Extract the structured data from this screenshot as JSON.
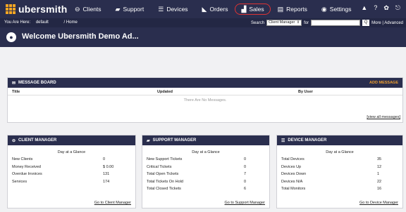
{
  "app": {
    "logo_text": "ubersmith"
  },
  "nav": [
    {
      "label": "Clients",
      "icon": "user-circle-icon",
      "glyph": "⊖"
    },
    {
      "label": "Support",
      "icon": "folder-icon",
      "glyph": "▰"
    },
    {
      "label": "Devices",
      "icon": "server-icon",
      "glyph": "☰"
    },
    {
      "label": "Orders",
      "icon": "tag-icon",
      "glyph": "◣"
    },
    {
      "label": "Sales",
      "icon": "bar-chart-icon",
      "glyph": "▟"
    },
    {
      "label": "Reports",
      "icon": "report-icon",
      "glyph": "▤"
    },
    {
      "label": "Settings",
      "icon": "settings-icon",
      "glyph": "◉"
    }
  ],
  "top_icons": {
    "bell": "▲",
    "help": "?",
    "gear": "✿",
    "logout": "⎋"
  },
  "subbar": {
    "you_are_here": "You Are Here:",
    "brand": "default",
    "breadcrumb_sep": "/",
    "breadcrumb_home": "Home",
    "search_label": "Search",
    "search_select": "Client Manager",
    "for_label": "for",
    "search_value": "",
    "search_button": "Q",
    "more_link": "More | Advanced"
  },
  "welcome": {
    "title": "Welcome Ubersmith Demo Ad..."
  },
  "message_board": {
    "title": "MESSAGE BOARD",
    "add_label": "ADD MESSAGE",
    "columns": [
      "Title",
      "Updated",
      "By User"
    ],
    "empty": "There Are No Messages.",
    "view_all": "[view all messages]"
  },
  "client_manager": {
    "title": "CLIENT MANAGER",
    "glance": "Day at a Glance",
    "rows": [
      {
        "label": "New Clients",
        "value": "0"
      },
      {
        "label": "Money Received",
        "value": "$ 0.00"
      },
      {
        "label": "Overdue Invoices",
        "value": "131"
      },
      {
        "label": "Services",
        "value": "174"
      }
    ],
    "link": "Go to Client Manager"
  },
  "support_manager": {
    "title": "SUPPORT MANAGER",
    "glance": "Day at a Glance",
    "rows": [
      {
        "label": "New Support Tickets",
        "value": "0"
      },
      {
        "label": "Critical Tickets",
        "value": "0"
      },
      {
        "label": "Total Open Tickets",
        "value": "7"
      },
      {
        "label": "Total Tickets On Hold",
        "value": "0"
      },
      {
        "label": "Total Closed Tickets",
        "value": "6"
      }
    ],
    "link": "Go to Support Manager"
  },
  "device_manager": {
    "title": "DEVICE MANAGER",
    "glance": "Day at a Glance",
    "rows": [
      {
        "label": "Total Devices",
        "value": "35"
      },
      {
        "label": "Devices Up",
        "value": "12"
      },
      {
        "label": "Devices Down",
        "value": "1"
      },
      {
        "label": "Devices N/A",
        "value": "22"
      },
      {
        "label": "Total Monitors",
        "value": "16"
      }
    ],
    "link": "Go to Device Manager"
  },
  "colors": {
    "nav_bg": "#2a2e4e",
    "accent": "#f0a030",
    "highlight_circle": "#dd3333"
  }
}
